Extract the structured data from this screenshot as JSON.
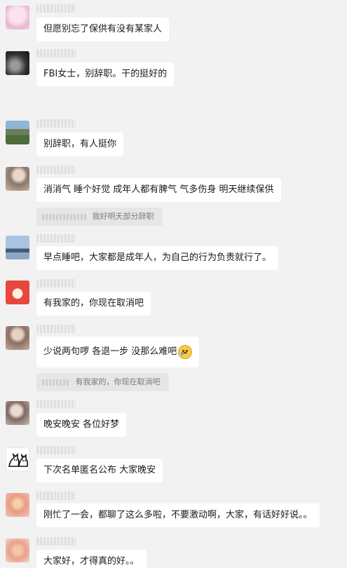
{
  "messages": [
    {
      "avatar": "pink-character-avatar",
      "text": "但愿别忘了保供有没有某家人"
    },
    {
      "avatar": "dark-photo-avatar",
      "text": "FBI女士，别辞职。干的挺好的"
    },
    {
      "avatar": "mountain-landscape-avatar",
      "text": "别辞职，有人挺你"
    },
    {
      "avatar": "girl-portrait-avatar",
      "text": "消消气 睡个好觉 成年人都有脾气 气多伤身 明天继续保供",
      "quote": "我好明天部分辞职"
    },
    {
      "avatar": "bridge-photo-avatar",
      "text": "早点睡吧，大家都是成年人，为自己的行为负责就行了。"
    },
    {
      "avatar": "red-cartoon-avatar",
      "text": "有我家的，你现在取消吧"
    },
    {
      "avatar": "girl-portrait-avatar",
      "text": "少说两句啰 各退一步 没那么难吧",
      "emoji": "crying-face-emoji",
      "quote": "有我家的，你现在取消吧"
    },
    {
      "avatar": "girl-portrait-avatar",
      "text": "晚安晚安 各位好梦"
    },
    {
      "avatar": "cats-drawing-avatar",
      "text": "下次名单匿名公布 大家晚安"
    },
    {
      "avatar": "flower-photo-avatar",
      "text": "刚忙了一会，都聊了这么多啦，不要激动啊，大家，有话好好说。。"
    },
    {
      "avatar": "flower-photo-avatar",
      "text": "大家好，才得真的好。。"
    }
  ]
}
